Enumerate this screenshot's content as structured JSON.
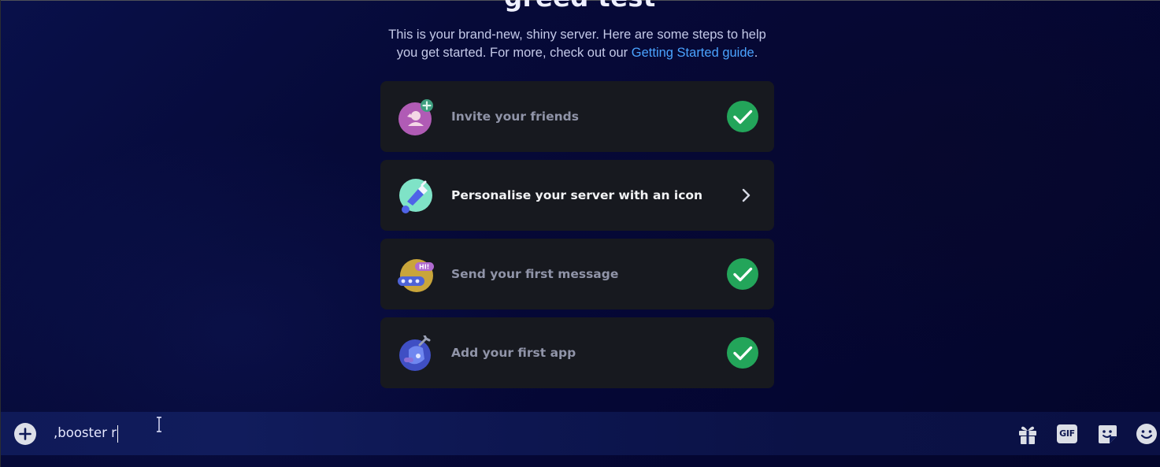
{
  "server": {
    "title": "greed test"
  },
  "intro": {
    "text_before_link": "This is your brand-new, shiny server. Here are some steps to help you get started. For more, check out our ",
    "link_text": "Getting Started guide",
    "text_after_link": "."
  },
  "checklist": [
    {
      "label": "Invite your friends",
      "completed": true,
      "icon": "invite-friends-icon"
    },
    {
      "label": "Personalise your server with an icon",
      "completed": false,
      "icon": "personalise-icon"
    },
    {
      "label": "Send your first message",
      "completed": true,
      "icon": "message-icon"
    },
    {
      "label": "Add your first app",
      "completed": true,
      "icon": "app-icon"
    }
  ],
  "composer": {
    "input_value": ",booster r"
  },
  "colors": {
    "check_green": "#23a55a",
    "link_blue": "#4aa3ff",
    "card_bg": "#17191f"
  }
}
